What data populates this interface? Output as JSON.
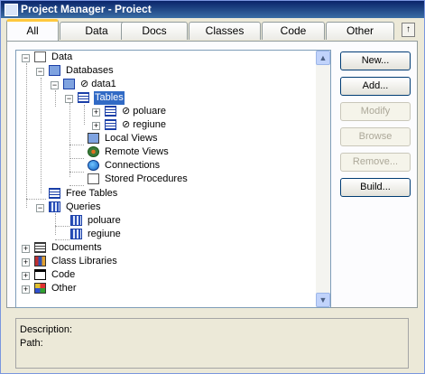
{
  "window": {
    "title": "Project Manager - Proiect",
    "icon": "project-icon"
  },
  "tabs": [
    {
      "label": "All",
      "active": true
    },
    {
      "label": "Data",
      "active": false
    },
    {
      "label": "Docs",
      "active": false
    },
    {
      "label": "Classes",
      "active": false
    },
    {
      "label": "Code",
      "active": false
    },
    {
      "label": "Other",
      "active": false
    }
  ],
  "tab_scroll": "↑",
  "tree": {
    "data": "Data",
    "databases": "Databases",
    "data1": "⊘ data1",
    "tables": "Tables",
    "poluare_table": "⊘ poluare",
    "regiune_table": "⊘ regiune",
    "local_views": "Local Views",
    "remote_views": "Remote Views",
    "connections": "Connections",
    "stored_procedures": "Stored Procedures",
    "free_tables": "Free Tables",
    "queries": "Queries",
    "poluare_query": "poluare",
    "regiune_query": "regiune",
    "documents": "Documents",
    "class_libraries": "Class Libraries",
    "code": "Code",
    "other": "Other"
  },
  "buttons": {
    "new": "New...",
    "add": "Add...",
    "modify": "Modify",
    "browse": "Browse",
    "remove": "Remove...",
    "build": "Build..."
  },
  "description": {
    "label": "Description:",
    "path_label": "Path:"
  },
  "colors": {
    "title_bar": "#0a246a",
    "selection": "#316ac5",
    "tab_highlight": "#ffc83c"
  }
}
